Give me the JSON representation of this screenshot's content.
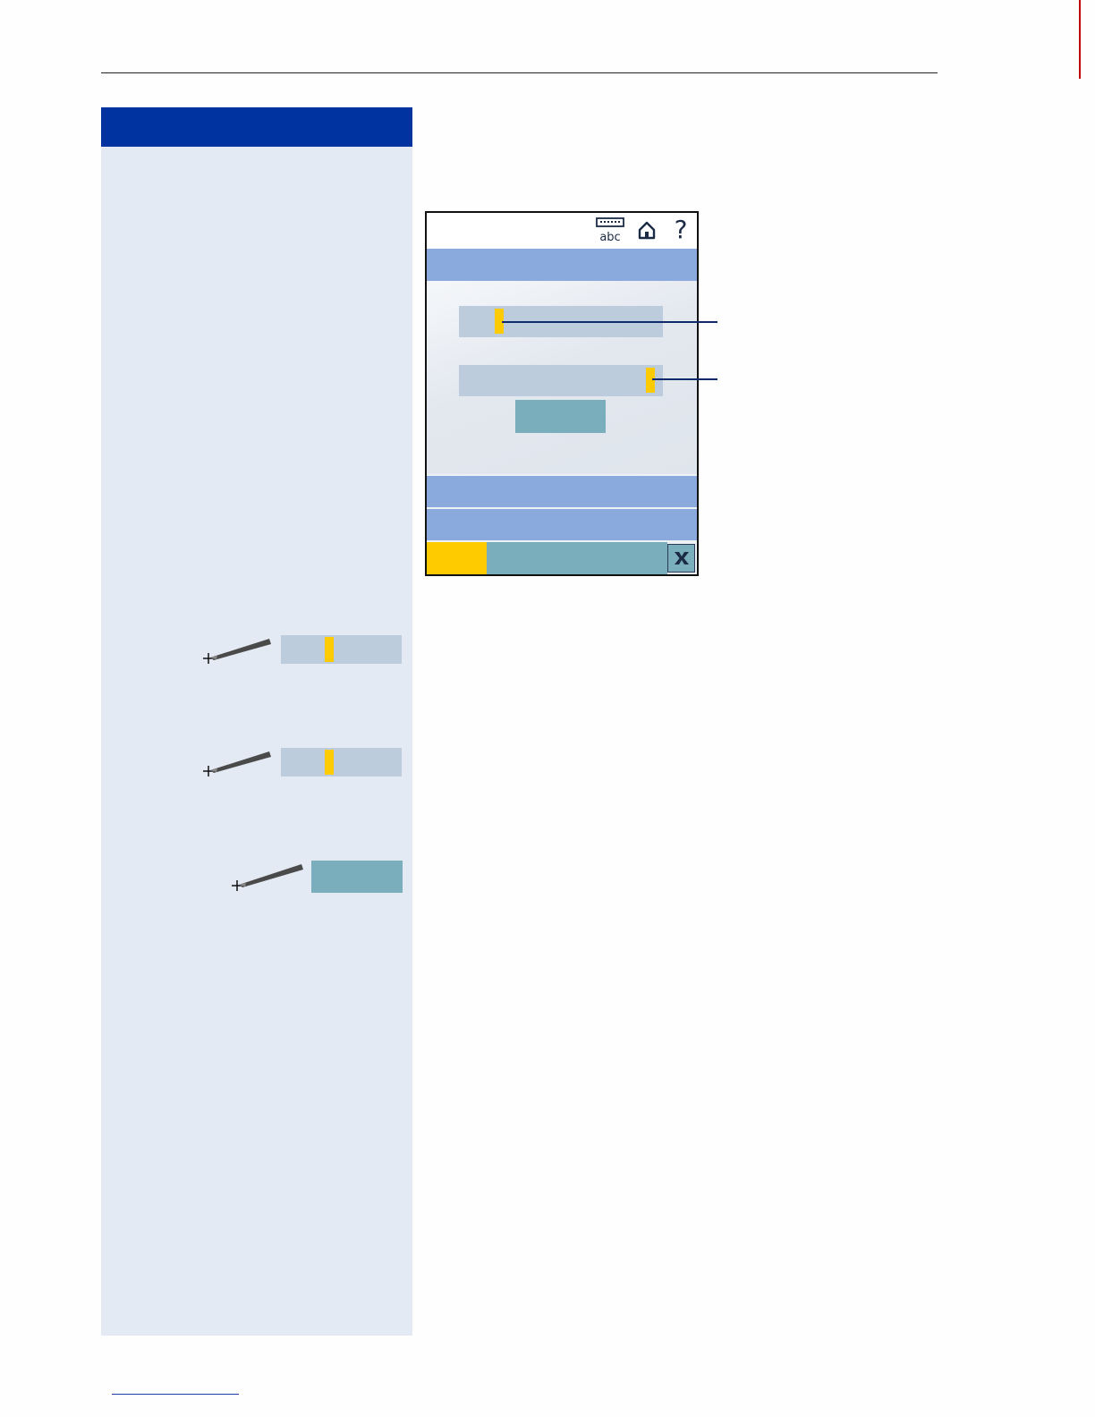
{
  "colors": {
    "header_blue": "#0033a0",
    "sidebar_bg": "#e4eaf4",
    "screen_bar": "#8aaade",
    "field": "#bcccdc",
    "cursor": "#fecb00",
    "button_teal": "#7aaebd"
  },
  "phone": {
    "icons": [
      "keyboard-abc-icon",
      "home-icon",
      "help-icon"
    ],
    "keyboard_label": "abc",
    "help_glyph": "?",
    "close_glyph": "✕"
  }
}
